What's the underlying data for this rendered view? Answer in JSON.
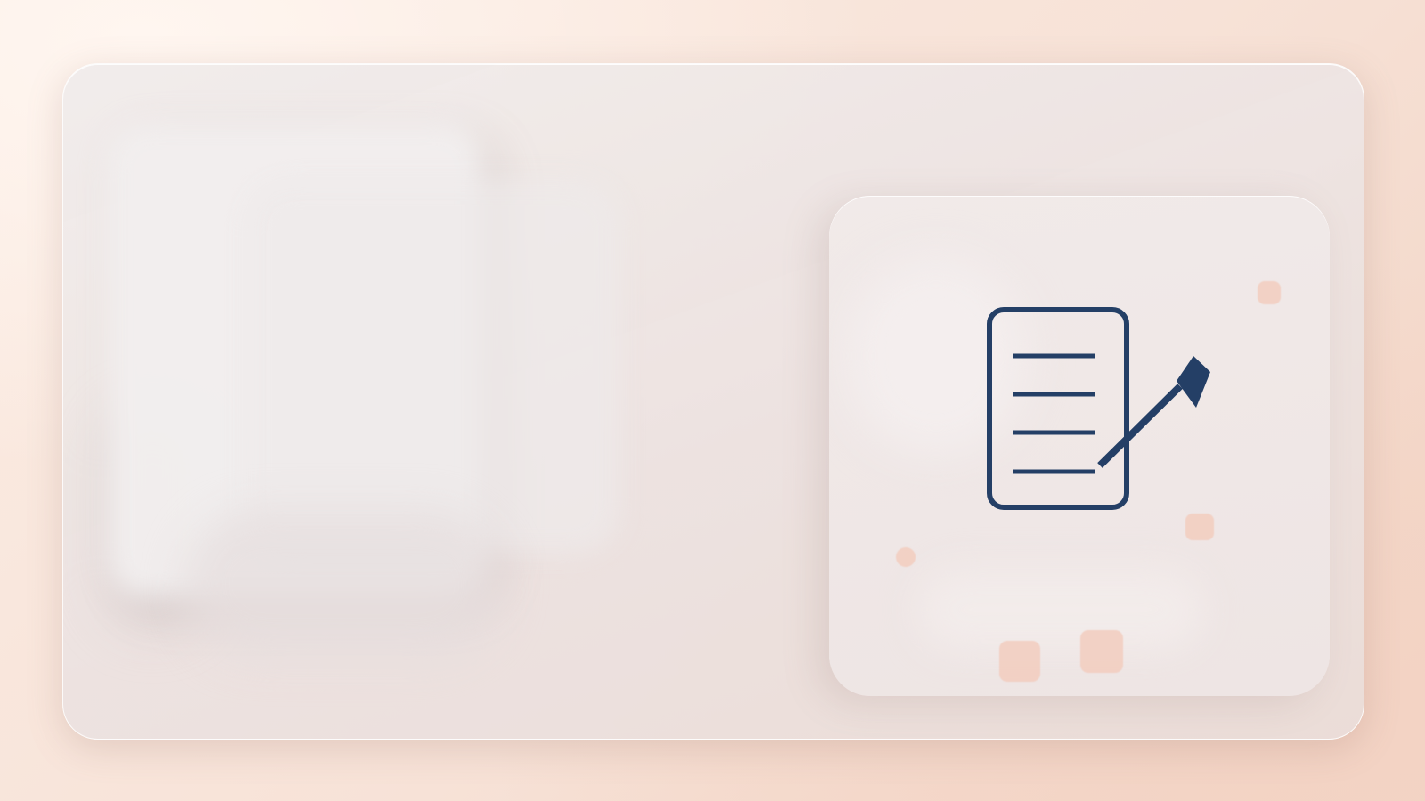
{
  "scene": {
    "background_colors": [
      "#fbece3",
      "#f7e2d7",
      "#f1d3c3"
    ],
    "panel_color": "#eee6e4",
    "card_color": "#efe7e6",
    "accent_color": "#f2cdbe",
    "icon_color": "#243f66"
  },
  "icon_card": {
    "icon": "document-signing-icon"
  }
}
